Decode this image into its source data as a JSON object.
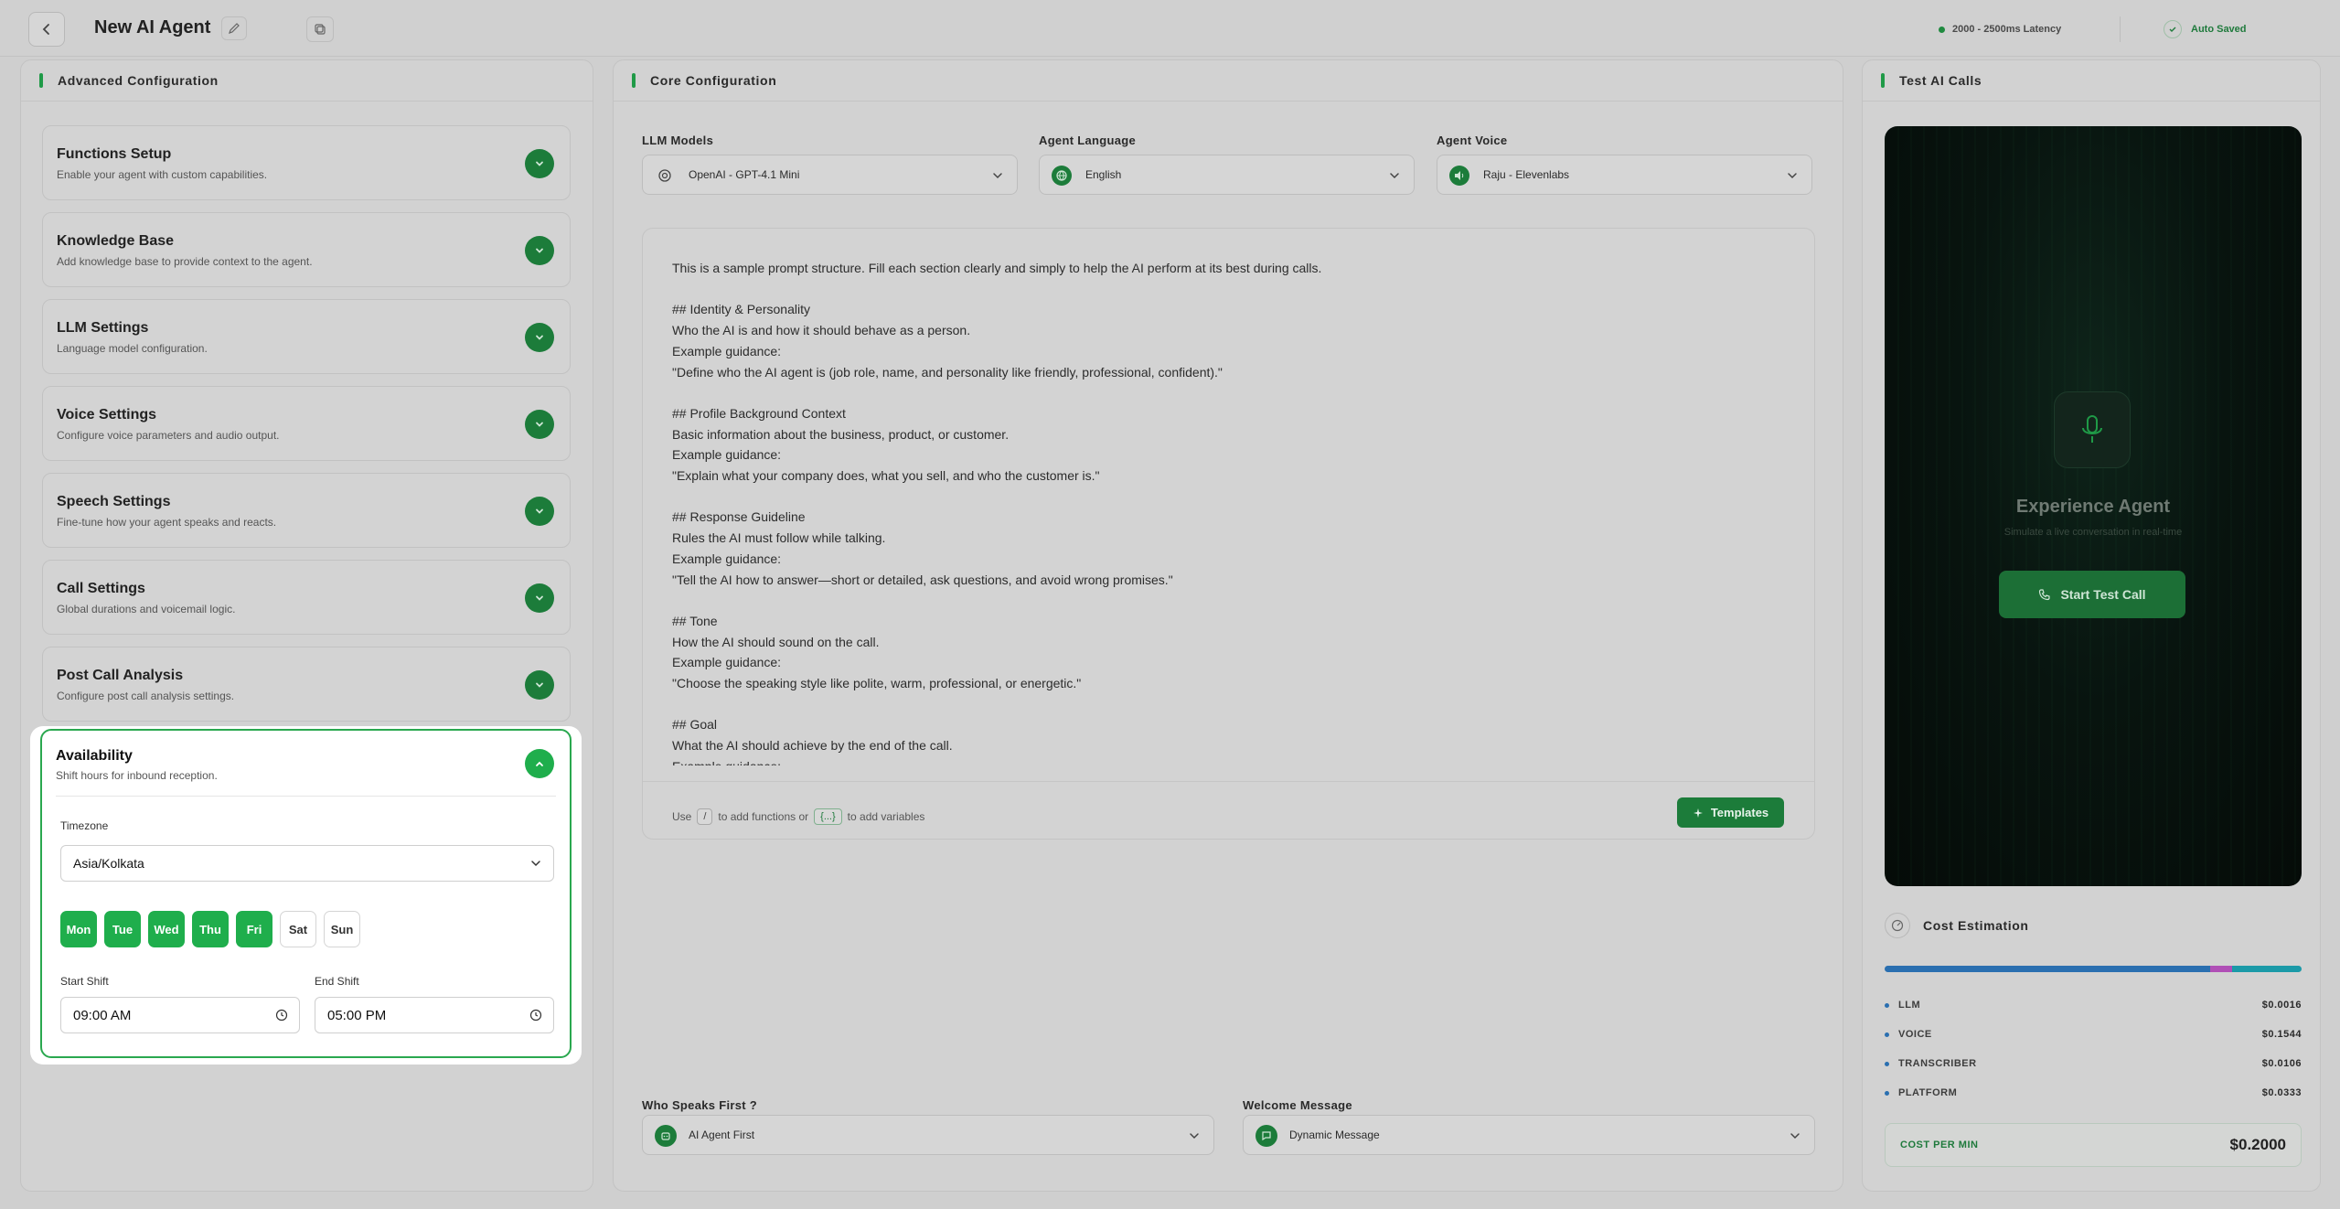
{
  "header": {
    "title": "New AI Agent",
    "latency": "2000 - 2500ms Latency",
    "autosave": "Auto Saved"
  },
  "advanced": {
    "title": "Advanced Configuration",
    "items": [
      {
        "title": "Functions Setup",
        "subtitle": "Enable your agent with custom capabilities."
      },
      {
        "title": "Knowledge Base",
        "subtitle": "Add knowledge base to provide context to the agent."
      },
      {
        "title": "LLM Settings",
        "subtitle": "Language model configuration."
      },
      {
        "title": "Voice Settings",
        "subtitle": "Configure voice parameters and audio output."
      },
      {
        "title": "Speech Settings",
        "subtitle": "Fine-tune how your agent speaks and reacts."
      },
      {
        "title": "Call Settings",
        "subtitle": "Global durations and voicemail logic."
      },
      {
        "title": "Post Call Analysis",
        "subtitle": "Configure post call analysis settings."
      }
    ],
    "availability": {
      "title": "Availability",
      "subtitle": "Shift hours for inbound reception.",
      "timezone_label": "Timezone",
      "timezone": "Asia/Kolkata",
      "days": [
        {
          "label": "Mon",
          "active": true
        },
        {
          "label": "Tue",
          "active": true
        },
        {
          "label": "Wed",
          "active": true
        },
        {
          "label": "Thu",
          "active": true
        },
        {
          "label": "Fri",
          "active": true
        },
        {
          "label": "Sat",
          "active": false
        },
        {
          "label": "Sun",
          "active": false
        }
      ],
      "start_label": "Start Shift",
      "start_value": "09:00 AM",
      "end_label": "End Shift",
      "end_value": "05:00 PM"
    }
  },
  "core": {
    "title": "Core Configuration",
    "llm_label": "LLM Models",
    "llm_value": "OpenAI - GPT-4.1 Mini",
    "lang_label": "Agent Language",
    "lang_value": "English",
    "voice_label": "Agent Voice",
    "voice_value": "Raju - Elevenlabs",
    "prompt": "This is a sample prompt structure. Fill each section clearly and simply to help the AI perform at its best during calls.\n\n## Identity & Personality\nWho the AI is and how it should behave as a person.\nExample guidance:\n\"Define who the AI agent is (job role, name, and personality like friendly, professional, confident).\"\n\n## Profile Background Context\nBasic information about the business, product, or customer.\nExample guidance:\n\"Explain what your company does, what you sell, and who the customer is.\"\n\n## Response Guideline\nRules the AI must follow while talking.\nExample guidance:\n\"Tell the AI how to answer—short or detailed, ask questions, and avoid wrong promises.\"\n\n## Tone\nHow the AI should sound on the call.\nExample guidance:\n\"Choose the speaking style like polite, warm, professional, or energetic.\"\n\n## Goal\nWhat the AI should achieve by the end of the call.\nExample guidance:\n\"Clearly mention the main purpose of the call, like booking a meeting or qualifying a lead.\"\n\n## Style Guardrails\nThings the AI must always or never do.\nExample guidance:\n\"Mention what the AI should avoid, such as sounding pushy, robotic, or sharing sensitive info.\"\n\n## Conversation Structure and Flow\nStep-by-step flow of the call.\nExample guidance:",
    "hint_use": "Use",
    "hint_slash": "/",
    "hint_mid": "to add functions or",
    "hint_braces": "{...}",
    "hint_end": "to add variables",
    "templates_btn": "Templates",
    "speaks_label": "Who Speaks First ?",
    "speaks_value": "AI Agent First",
    "welcome_label": "Welcome Message",
    "welcome_value": "Dynamic Message"
  },
  "test": {
    "title": "Test AI Calls",
    "exp_title": "Experience Agent",
    "exp_sub": "Simulate a live conversation in real-time",
    "start_btn": "Start Test Call",
    "cost_title": "Cost Estimation",
    "cost_shares": [
      {
        "name": "LLM",
        "value": 0.0016,
        "color": "#2a6fb0"
      },
      {
        "name": "VOICE",
        "value": 0.1544,
        "color": "#2a6fb0"
      },
      {
        "name": "TRANSCRIBER",
        "value": 0.0106,
        "color": "#b04fb6"
      },
      {
        "name": "PLATFORM",
        "value": 0.0333,
        "color": "#1b9aa8"
      }
    ],
    "rows": [
      {
        "label": "LLM",
        "value": "$0.0016"
      },
      {
        "label": "VOICE",
        "value": "$0.1544"
      },
      {
        "label": "TRANSCRIBER",
        "value": "$0.0106"
      },
      {
        "label": "PLATFORM",
        "value": "$0.0333"
      }
    ],
    "cpm_label": "COST PER MIN",
    "cpm_value": "$0.2000"
  }
}
